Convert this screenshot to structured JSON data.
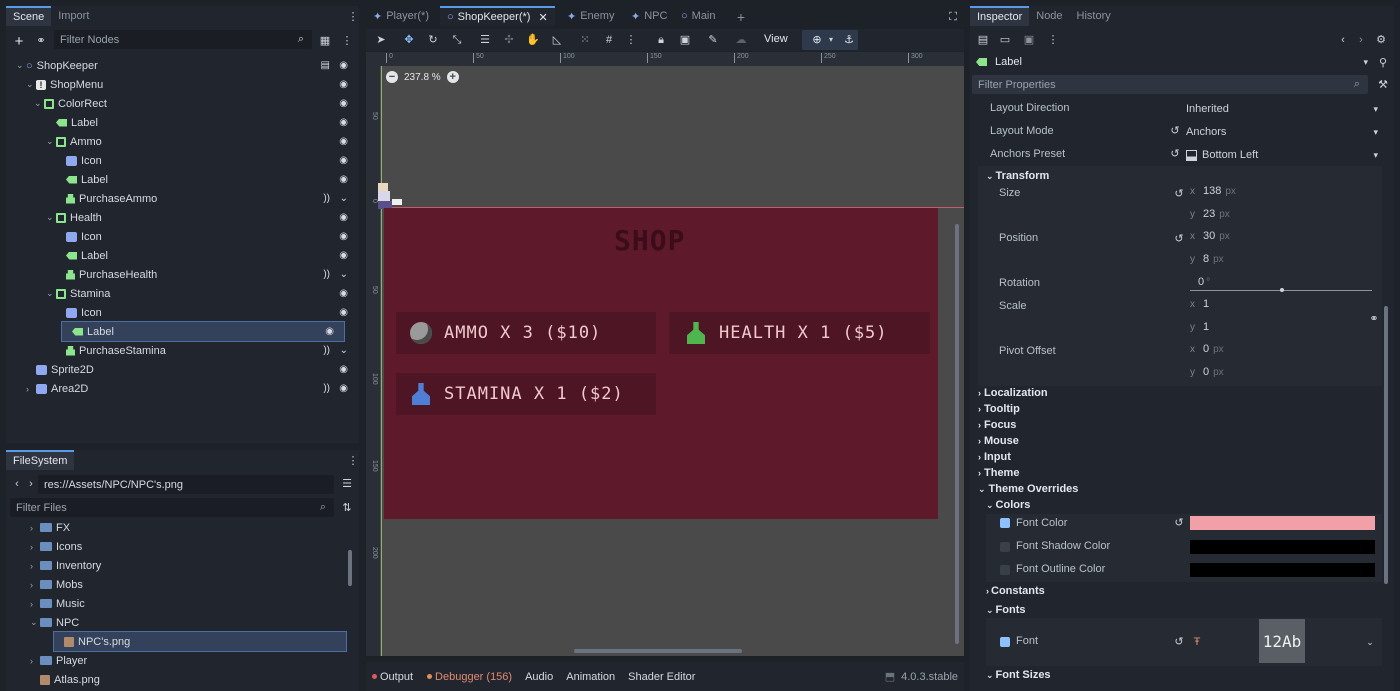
{
  "scene_dock": {
    "tabs": [
      "Scene",
      "Import"
    ],
    "filter_placeholder": "Filter Nodes",
    "nodes": [
      {
        "label": "ShopKeeper",
        "icon": "node2d-icon"
      },
      {
        "label": "ShopMenu",
        "icon": "control-icon"
      },
      {
        "label": "ColorRect",
        "icon": "colorrect-icon"
      },
      {
        "label": "Label",
        "icon": "label-icon"
      },
      {
        "label": "Ammo",
        "icon": "colorrect-icon"
      },
      {
        "label": "Icon",
        "icon": "texture-icon"
      },
      {
        "label": "Label",
        "icon": "label-icon"
      },
      {
        "label": "PurchaseAmmo",
        "icon": "button-icon"
      },
      {
        "label": "Health",
        "icon": "colorrect-icon"
      },
      {
        "label": "Icon",
        "icon": "texture-icon"
      },
      {
        "label": "Label",
        "icon": "label-icon"
      },
      {
        "label": "PurchaseHealth",
        "icon": "button-icon"
      },
      {
        "label": "Stamina",
        "icon": "colorrect-icon"
      },
      {
        "label": "Icon",
        "icon": "texture-icon"
      },
      {
        "label": "Label",
        "icon": "label-icon"
      },
      {
        "label": "PurchaseStamina",
        "icon": "button-icon"
      },
      {
        "label": "Sprite2D",
        "icon": "sprite-icon"
      },
      {
        "label": "Area2D",
        "icon": "area-icon"
      }
    ]
  },
  "filesystem": {
    "title": "FileSystem",
    "path": "res://Assets/NPC/NPC's.png",
    "filter_placeholder": "Filter Files",
    "items": [
      "FX",
      "Icons",
      "Inventory",
      "Mobs",
      "Music",
      "NPC",
      "NPC's.png",
      "Player",
      "Atlas.png"
    ]
  },
  "editor_tabs": [
    "Player(*)",
    "ShopKeeper(*)",
    "Enemy",
    "NPC",
    "Main"
  ],
  "toolbar": {
    "view_label": "View"
  },
  "viewport": {
    "zoom": "237.8 %",
    "ruler_top": [
      "0",
      "50",
      "100",
      "150",
      "200",
      "250",
      "300"
    ],
    "ruler_left": [
      "50",
      "0",
      "50",
      "100",
      "150",
      "200"
    ]
  },
  "shop": {
    "title": "SHOP",
    "items": [
      "AMMO X 3 ($10)",
      "HEALTH X 1 ($5)",
      "STAMINA X 1 ($2)"
    ]
  },
  "bottom_bar": {
    "output": "Output",
    "debugger": "Debugger (156)",
    "audio": "Audio",
    "animation": "Animation",
    "shader": "Shader Editor",
    "version": "4.0.3.stable"
  },
  "inspector": {
    "tabs": [
      "Inspector",
      "Node",
      "History"
    ],
    "node_type": "Label",
    "filter_placeholder": "Filter Properties",
    "layout_direction_label": "Layout Direction",
    "layout_direction_value": "Inherited",
    "layout_mode_label": "Layout Mode",
    "layout_mode_value": "Anchors",
    "anchors_preset_label": "Anchors Preset",
    "anchors_preset_value": "Bottom Left",
    "transform": "Transform",
    "size_label": "Size",
    "size_x": "138",
    "size_y": "23",
    "position_label": "Position",
    "pos_x": "30",
    "pos_y": "8",
    "rotation_label": "Rotation",
    "rotation_value": "0",
    "scale_label": "Scale",
    "scale_x": "1",
    "scale_y": "1",
    "pivot_label": "Pivot Offset",
    "pivot_x": "0",
    "pivot_y": "0",
    "unit_px": "px",
    "unit_deg": "°",
    "sections": [
      "Localization",
      "Tooltip",
      "Focus",
      "Mouse",
      "Input",
      "Theme",
      "Theme Overrides"
    ],
    "colors": "Colors",
    "font_color": "Font Color",
    "font_shadow": "Font Shadow Color",
    "font_outline": "Font Outline Color",
    "constants": "Constants",
    "fonts": "Fonts",
    "font": "Font",
    "font_preview": "12Ab",
    "font_sizes": "Font Sizes",
    "font_color_hex": "#f2a0a8"
  }
}
